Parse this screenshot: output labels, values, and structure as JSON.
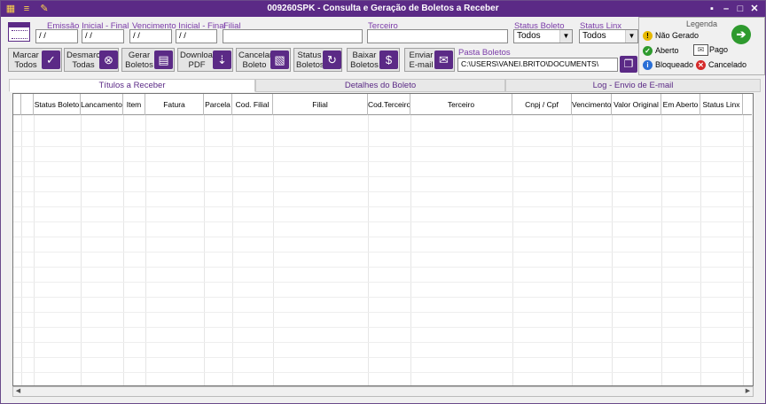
{
  "window": {
    "title": "009260SPK - Consulta e Geração de Boletos a Receber"
  },
  "filters": {
    "emissao_label": "Emissão Inicial - Final",
    "emissao_inicial": " / /",
    "emissao_final": " / /",
    "vencimento_label": "Vencimento Inicial - Final",
    "vencimento_inicial": " / /",
    "vencimento_final": " / /",
    "filial_label": "Filial",
    "filial_value": "",
    "terceiro_label": "Terceiro",
    "terceiro_value": "",
    "status_boleto_label": "Status Boleto",
    "status_boleto_value": "Todos",
    "status_linx_label": "Status Linx",
    "status_linx_value": "Todos",
    "pasta_label": "Pasta Boletos",
    "pasta_value": "C:\\USERS\\VANEI.BRITO\\DOCUMENTS\\"
  },
  "actions": {
    "marcar": "Marcar Todos",
    "desmarcar": "Desmarcar Todas",
    "gerar": "Gerar Boletos",
    "download": "Download PDF",
    "cancelar": "Cancelar Boleto",
    "status": "Status Boletos",
    "baixar": "Baixar Boletos",
    "enviar": "Enviar E-mail"
  },
  "legend": {
    "title": "Legenda",
    "nao_gerado": "Não Gerado",
    "aberto": "Aberto",
    "pago": "Pago",
    "bloqueado": "Bloqueado",
    "cancelado": "Cancelado"
  },
  "tabs": [
    {
      "label": "Títulos a Receber"
    },
    {
      "label": "Detalhes do Boleto"
    },
    {
      "label": "Log - Envio de E-mail"
    }
  ],
  "grid": {
    "columns": [
      "Status Boleto",
      "Lancamento",
      "Item",
      "Fatura",
      "Parcela",
      "Cod. Filial",
      "Filial",
      "Cod.Terceiro",
      "Terceiro",
      "Cnpj / Cpf",
      "Vencimento",
      "Valor Original",
      "Em Aberto",
      "Status Linx"
    ]
  },
  "colors": {
    "accent": "#5b2a86",
    "label": "#7a3aa8"
  }
}
